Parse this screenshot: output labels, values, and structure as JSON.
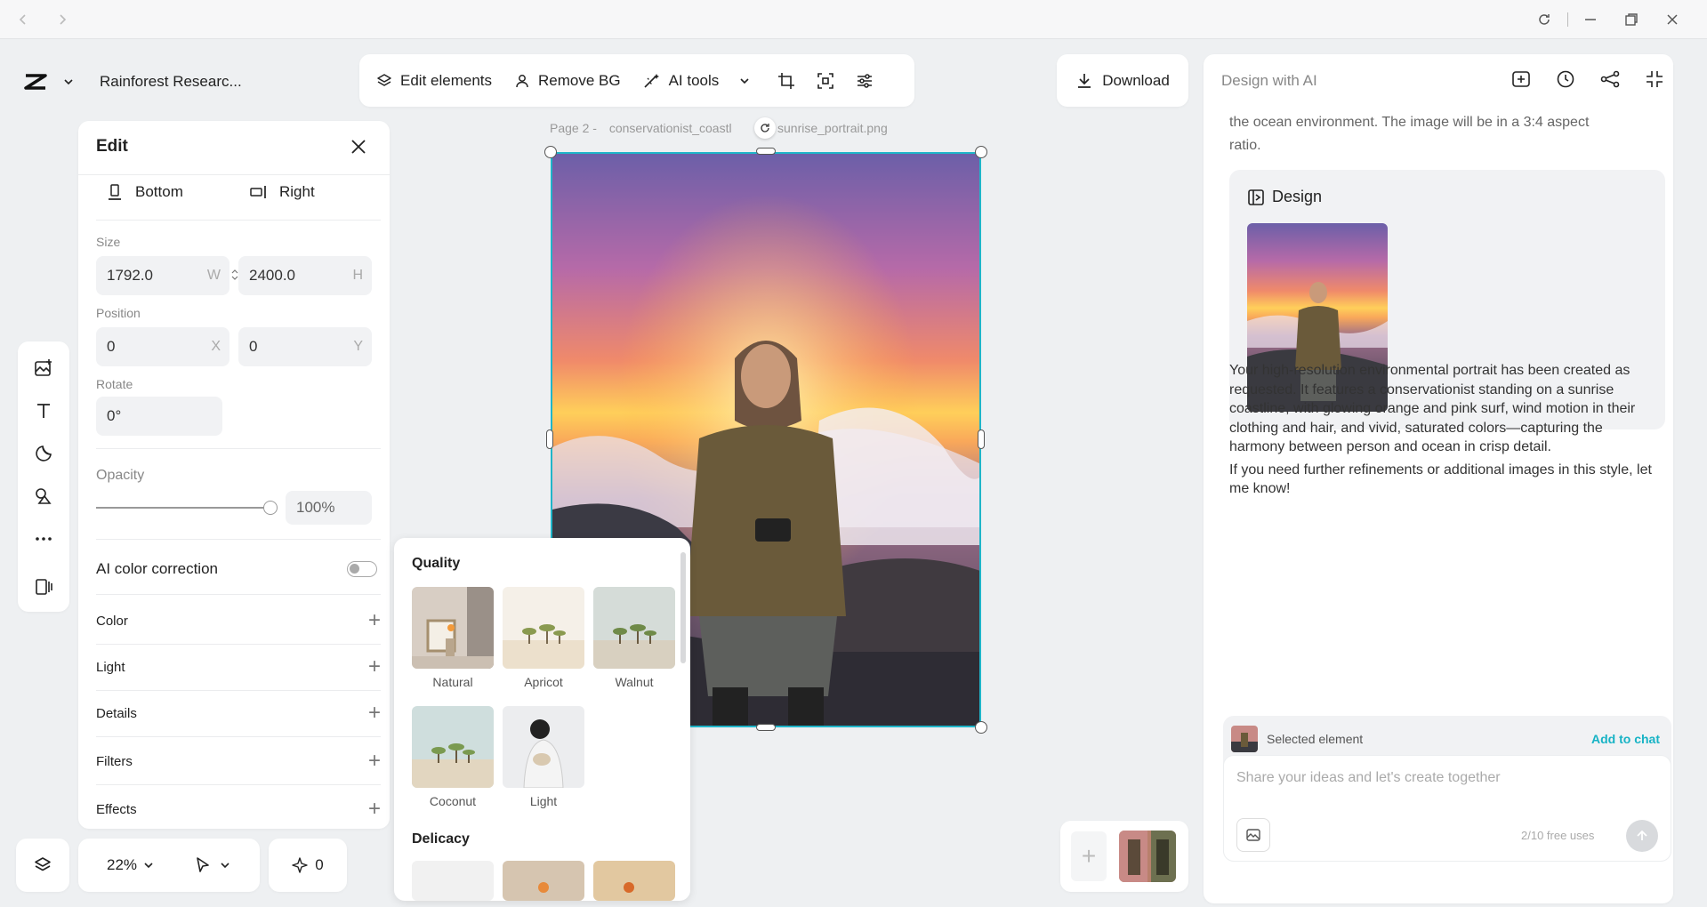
{
  "titlebar": {
    "back_icon": "chevron-left-icon",
    "forward_icon": "chevron-right-icon",
    "refresh_icon": "refresh-icon",
    "minimize_icon": "minimize-icon",
    "restore_icon": "restore-icon",
    "close_icon": "close-icon"
  },
  "header": {
    "project_name": "Rainforest Researc..."
  },
  "toolbar": {
    "edit_elements": "Edit elements",
    "remove_bg": "Remove BG",
    "ai_tools": "AI tools"
  },
  "download": {
    "label": "Download"
  },
  "edit_panel": {
    "title": "Edit",
    "align_bottom": "Bottom",
    "align_right": "Right",
    "size_label": "Size",
    "width": "1792.0",
    "width_unit": "W",
    "height": "2400.0",
    "height_unit": "H",
    "position_label": "Position",
    "x": "0",
    "x_unit": "X",
    "y": "0",
    "y_unit": "Y",
    "rotate_label": "Rotate",
    "rotate": "0°",
    "opacity_label": "Opacity",
    "opacity": "100%",
    "opacity_fraction": 1.0,
    "ai_color_correction": "AI color correction",
    "ai_color_correction_on": false,
    "sections": [
      "Color",
      "Light",
      "Details",
      "Filters",
      "Effects"
    ]
  },
  "filters_popup": {
    "quality_title": "Quality",
    "quality_items": [
      "Natural",
      "Apricot",
      "Walnut",
      "Coconut",
      "Light"
    ],
    "delicacy_title": "Delicacy"
  },
  "canvas": {
    "page_label": "Page 2 -",
    "file_name": "conservationist_coastl",
    "file_name_end": "sunrise_portrait.png"
  },
  "bottom_bar": {
    "zoom": "22%",
    "count": "0"
  },
  "ai_panel": {
    "title": "Design with AI",
    "intro_line1": "the ocean environment. The image will be in a 3:4 aspect",
    "intro_line2": "ratio.",
    "design_card_title": "Design",
    "message1": "Your high-resolution environmental portrait has been created as requested. It features a conservationist standing on a sunrise coastline, with glowing orange and pink surf, wind motion in their clothing and hair, and vivid, saturated colors—capturing the harmony between person and ocean in crisp detail.",
    "message2": "If you need further refinements or additional images in this style, let me know!",
    "selected_element": "Selected element",
    "add_to_chat": "Add to chat",
    "input_placeholder": "Share your ideas and let's create together",
    "free_uses": "2/10 free uses"
  },
  "colors": {
    "accent": "#1fb5c9",
    "link": "#17b3c5",
    "bg": "#eef0f2"
  }
}
